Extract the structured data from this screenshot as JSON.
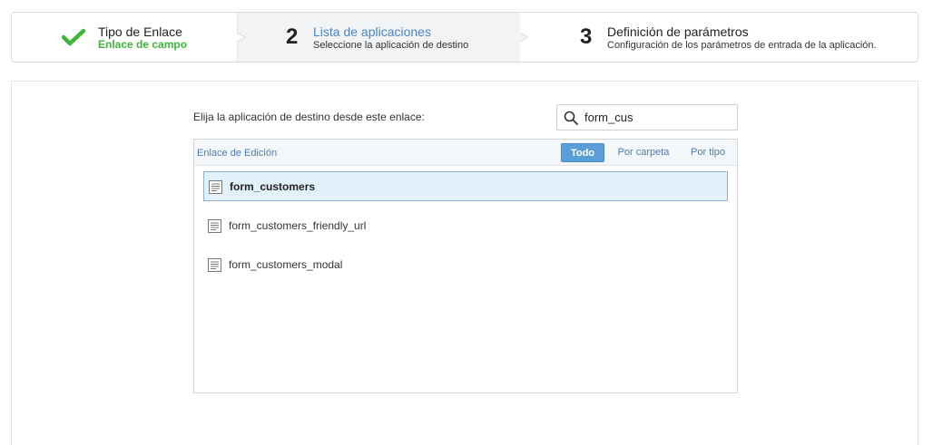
{
  "wizard": {
    "steps": [
      {
        "title": "Tipo de Enlace",
        "subtitle": "Enlace de campo",
        "status": "complete"
      },
      {
        "number": "2",
        "title": "Lista de aplicaciones",
        "subtitle": "Seleccione la aplicación de destino",
        "status": "active"
      },
      {
        "number": "3",
        "title": "Definición de parámetros",
        "subtitle": "Configuración de los parámetros de entrada de la aplicación.",
        "status": "pending"
      }
    ]
  },
  "main": {
    "prompt": "Elija la aplicación de destino desde este enlace:",
    "search": {
      "value": "form_cus",
      "icon": "search-icon"
    },
    "list": {
      "toolbar_title": "Enlace de Edición",
      "filters": {
        "all": "Todo",
        "by_folder": "Por carpeta",
        "by_type": "Por tipo"
      },
      "active_filter": "all",
      "items": [
        {
          "label": "form_customers",
          "selected": true,
          "icon": "form-app-icon"
        },
        {
          "label": "form_customers_friendly_url",
          "selected": false,
          "icon": "form-app-icon"
        },
        {
          "label": "form_customers_modal",
          "selected": false,
          "icon": "form-app-icon"
        }
      ]
    }
  },
  "colors": {
    "accent": "#4a86c5",
    "success": "#3fb43b",
    "active_step_bg": "#f2f3f5",
    "filter_active_bg": "#5b9dd6",
    "selected_row_bg": "#e3f1fb"
  }
}
